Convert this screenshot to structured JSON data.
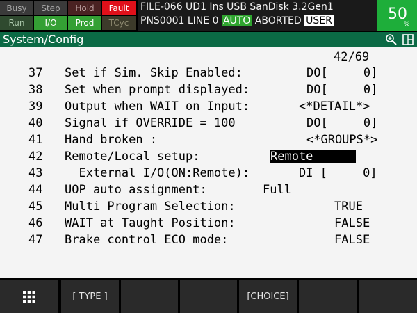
{
  "status": {
    "indicators_top": [
      "Busy",
      "Step",
      "Hold",
      "Fault"
    ],
    "indicators_bottom": [
      "Run",
      "I/O",
      "Prod",
      "TCyc"
    ],
    "line1": "FILE-066 UD1 Ins  USB  SanDisk 3.2Gen1",
    "line2_prefix": "PNS0001 LINE 0 ",
    "line2_auto": "AUTO",
    "line2_mid": " ABORTED ",
    "line2_user": "USER",
    "override_value": "50",
    "override_unit": "%"
  },
  "titlebar": {
    "title": "System/Config",
    "icons": [
      "zoom-in-icon",
      "window-split-icon"
    ]
  },
  "page": {
    "indicator": "42/69"
  },
  "rows": [
    {
      "num": "37",
      "label": "Set if Sim. Skip Enabled:",
      "value": "DO[     0]"
    },
    {
      "num": "38",
      "label": "Set when prompt displayed:",
      "value": "DO[     0]"
    },
    {
      "num": "39",
      "label": "Output when WAIT on Input:",
      "value": "<*DETAIL*>"
    },
    {
      "num": "40",
      "label": "Signal if OVERRIDE = 100",
      "value": "DO[     0]"
    },
    {
      "num": "41",
      "label": "Hand broken :",
      "value": "<*GROUPS*>"
    },
    {
      "num": "42",
      "label": "Remote/Local setup:",
      "value": "Remote      "
    },
    {
      "num": "43",
      "label": "  External I/O(ON:Remote):",
      "value": "DI [     0]"
    },
    {
      "num": "44",
      "label": "UOP auto assignment:",
      "value": "Full"
    },
    {
      "num": "45",
      "label": "Multi Program Selection:",
      "value": "TRUE"
    },
    {
      "num": "46",
      "label": "WAIT at Taught Position:",
      "value": "FALSE"
    },
    {
      "num": "47",
      "label": "Brake control ECO mode:",
      "value": "FALSE"
    }
  ],
  "fkeys": {
    "f0_icon": "grid-menu-icon",
    "f1": "[ TYPE ]",
    "f2": "",
    "f3": "",
    "f4": "[CHOICE]",
    "f5": "",
    "f6": ""
  }
}
